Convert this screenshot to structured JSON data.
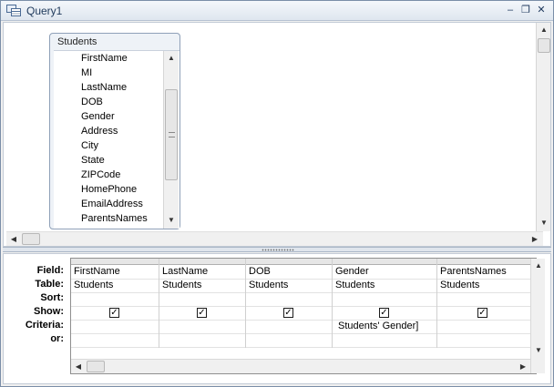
{
  "window": {
    "title": "Query1",
    "icon": "query-design-icon",
    "controls": [
      "minimize-icon",
      "restore-icon",
      "close-icon"
    ]
  },
  "table_box": {
    "title": "Students",
    "fields": [
      "FirstName",
      "MI",
      "LastName",
      "DOB",
      "Gender",
      "Address",
      "City",
      "State",
      "ZIPCode",
      "HomePhone",
      "EmailAddress",
      "ParentsNames"
    ]
  },
  "grid": {
    "row_labels": {
      "field": "Field:",
      "table": "Table:",
      "sort": "Sort:",
      "show": "Show:",
      "criteria": "Criteria:",
      "or": "or:"
    },
    "columns": [
      {
        "field": "FirstName",
        "table": "Students",
        "sort": "",
        "show": true,
        "criteria": "",
        "or": ""
      },
      {
        "field": "LastName",
        "table": "Students",
        "sort": "",
        "show": true,
        "criteria": "",
        "or": ""
      },
      {
        "field": "DOB",
        "table": "Students",
        "sort": "",
        "show": true,
        "criteria": "",
        "or": ""
      },
      {
        "field": "Gender",
        "table": "Students",
        "sort": "",
        "show": true,
        "criteria": "Students' Gender]",
        "or": ""
      },
      {
        "field": "ParentsNames",
        "table": "Students",
        "sort": "",
        "show": true,
        "criteria": "",
        "or": ""
      }
    ]
  },
  "colors": {
    "title_text": "#1e395b",
    "table_border": "#8fa0b8"
  }
}
